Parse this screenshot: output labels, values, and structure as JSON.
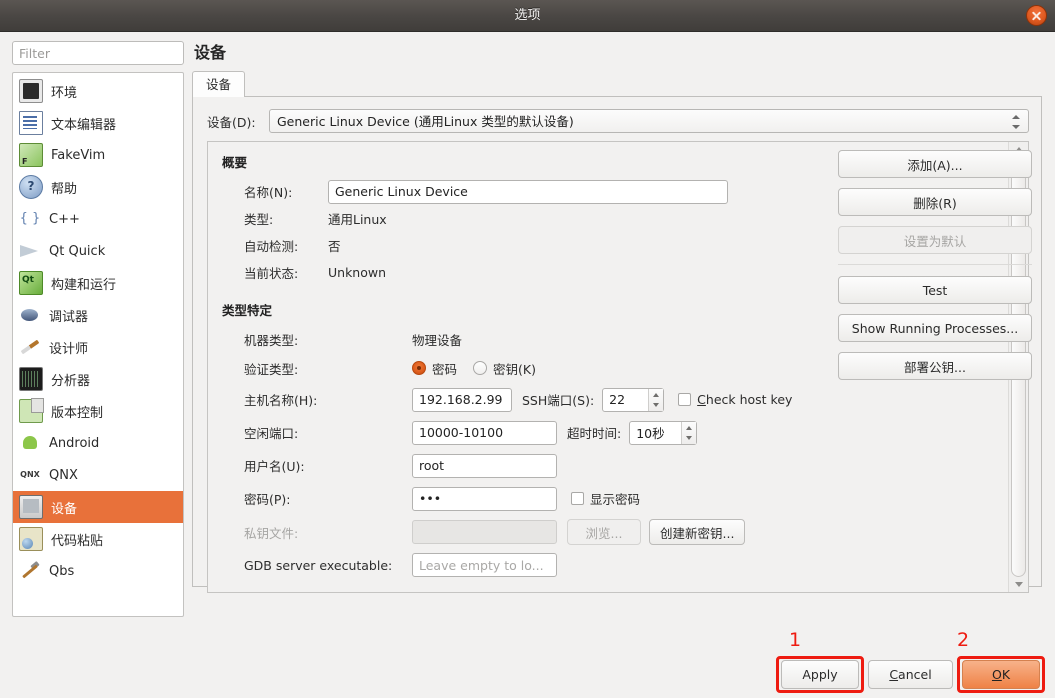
{
  "window": {
    "title": "选项",
    "close_icon": "close-icon"
  },
  "sidebar": {
    "filter_placeholder": "Filter",
    "items": [
      {
        "label": "环境",
        "icon": "monitor-icon"
      },
      {
        "label": "文本编辑器",
        "icon": "text-editor-icon"
      },
      {
        "label": "FakeVim",
        "icon": "fakevim-icon"
      },
      {
        "label": "帮助",
        "icon": "help-icon"
      },
      {
        "label": "C++",
        "icon": "braces-icon"
      },
      {
        "label": "Qt Quick",
        "icon": "qtquick-icon"
      },
      {
        "label": "构建和运行",
        "icon": "build-run-icon"
      },
      {
        "label": "调试器",
        "icon": "debugger-icon"
      },
      {
        "label": "设计师",
        "icon": "designer-icon"
      },
      {
        "label": "分析器",
        "icon": "analyzer-icon"
      },
      {
        "label": "版本控制",
        "icon": "version-control-icon"
      },
      {
        "label": "Android",
        "icon": "android-icon"
      },
      {
        "label": "QNX",
        "icon": "qnx-icon"
      },
      {
        "label": "设备",
        "icon": "device-icon",
        "selected": true
      },
      {
        "label": "代码粘贴",
        "icon": "code-paste-icon"
      },
      {
        "label": "Qbs",
        "icon": "qbs-icon"
      }
    ]
  },
  "page": {
    "title": "设备",
    "tab_label": "设备",
    "device_label": "设备(D):",
    "device_value": "Generic Linux Device (通用Linux 类型的默认设备)"
  },
  "overview": {
    "title": "概要",
    "name_label": "名称(N):",
    "name_value": "Generic Linux Device",
    "type_label": "类型:",
    "type_value": "通用Linux",
    "autodetect_label": "自动检测:",
    "autodetect_value": "否",
    "state_label": "当前状态:",
    "state_value": "Unknown"
  },
  "type_specific": {
    "title": "类型特定",
    "machine_type_label": "机器类型:",
    "machine_type_value": "物理设备",
    "auth_type_label": "验证类型:",
    "auth_password": "密码",
    "auth_key": "密钥(K)",
    "auth_selected": "密码",
    "host_label": "主机名称(H):",
    "host_value": "192.168.2.99",
    "ssh_port_label": "SSH端口(S):",
    "ssh_port_value": "22",
    "check_host_key_label": "Check host key",
    "check_host_key_checked": false,
    "free_ports_label": "空闲端口:",
    "free_ports_value": "10000-10100",
    "timeout_label": "超时时间:",
    "timeout_value": "10秒",
    "username_label": "用户名(U):",
    "username_value": "root",
    "password_label": "密码(P):",
    "password_value": "•••",
    "show_password_label": "显示密码",
    "show_password_checked": false,
    "private_key_label": "私钥文件:",
    "private_key_value": "",
    "browse_label": "浏览...",
    "create_key_label": "创建新密钥...",
    "gdb_label": "GDB server executable:",
    "gdb_placeholder": "Leave empty to lo..."
  },
  "side_buttons": {
    "add": "添加(A)...",
    "remove": "删除(R)",
    "set_default": "设置为默认",
    "test": "Test",
    "show_processes": "Show Running Processes...",
    "deploy_key": "部署公钥..."
  },
  "footer": {
    "apply": "Apply",
    "cancel": "Cancel",
    "ok": "OK",
    "annotation_1": "1",
    "annotation_2": "2"
  },
  "colors": {
    "accent_orange": "#e8713a",
    "annotation_red": "#ee1b10",
    "ok_button": "#ef8246"
  }
}
